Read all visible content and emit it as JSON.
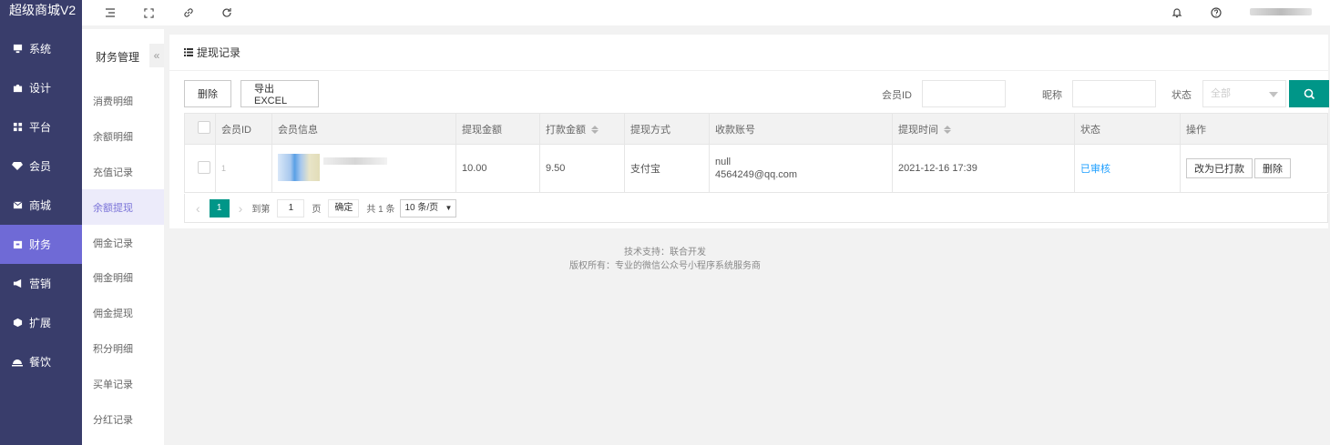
{
  "app": {
    "title": "超级商城V2"
  },
  "sidebar": {
    "items": [
      {
        "label": "系统",
        "icon": "monitor-icon"
      },
      {
        "label": "设计",
        "icon": "puzzle-icon"
      },
      {
        "label": "平台",
        "icon": "grid-icon"
      },
      {
        "label": "会员",
        "icon": "diamond-icon"
      },
      {
        "label": "商城",
        "icon": "mail-icon"
      },
      {
        "label": "财务",
        "icon": "wallet-icon",
        "active": true
      },
      {
        "label": "营销",
        "icon": "megaphone-icon"
      },
      {
        "label": "扩展",
        "icon": "cube-icon"
      },
      {
        "label": "餐饮",
        "icon": "cloche-icon"
      }
    ]
  },
  "subnav": {
    "title": "财务管理",
    "collapse": "«",
    "items": [
      "消费明细",
      "余额明细",
      "充值记录",
      "余额提现",
      "佣金记录",
      "佣金明细",
      "佣金提现",
      "积分明细",
      "买单记录",
      "分红记录"
    ],
    "active_index": 3
  },
  "panel": {
    "title": "提现记录",
    "delete_label": "删除",
    "export_label": "导出EXCEL",
    "member_id_label": "会员ID",
    "nickname_label": "昵称",
    "status_label": "状态",
    "status_value": "全部"
  },
  "table": {
    "headers": [
      "会员ID",
      "会员信息",
      "提现金额",
      "打款金额",
      "提现方式",
      "收款账号",
      "提现时间",
      "状态",
      "操作"
    ],
    "rows": [
      {
        "member_id": "1",
        "withdraw_amount": "10.00",
        "pay_amount": "9.50",
        "method": "支付宝",
        "account_line1": "null",
        "account_line2": "4564249@qq.com",
        "time": "2021-12-16 17:39",
        "status": "已审核",
        "op_paid": "改为已打款",
        "op_delete": "删除"
      }
    ]
  },
  "pager": {
    "current": "1",
    "goto_label": "到第",
    "page_input": "1",
    "page_unit": "页",
    "confirm": "确定",
    "total": "共 1 条",
    "per_page": "10 条/页"
  },
  "footer": {
    "line1": "技术支持：联合开发",
    "line2": "版权所有：专业的微信公众号小程序系统服务商"
  },
  "colors": {
    "sidebar": "#393D6B",
    "sidebar_active": "#6F6AD6",
    "accent": "#009688",
    "status": "#1E9FFF"
  }
}
